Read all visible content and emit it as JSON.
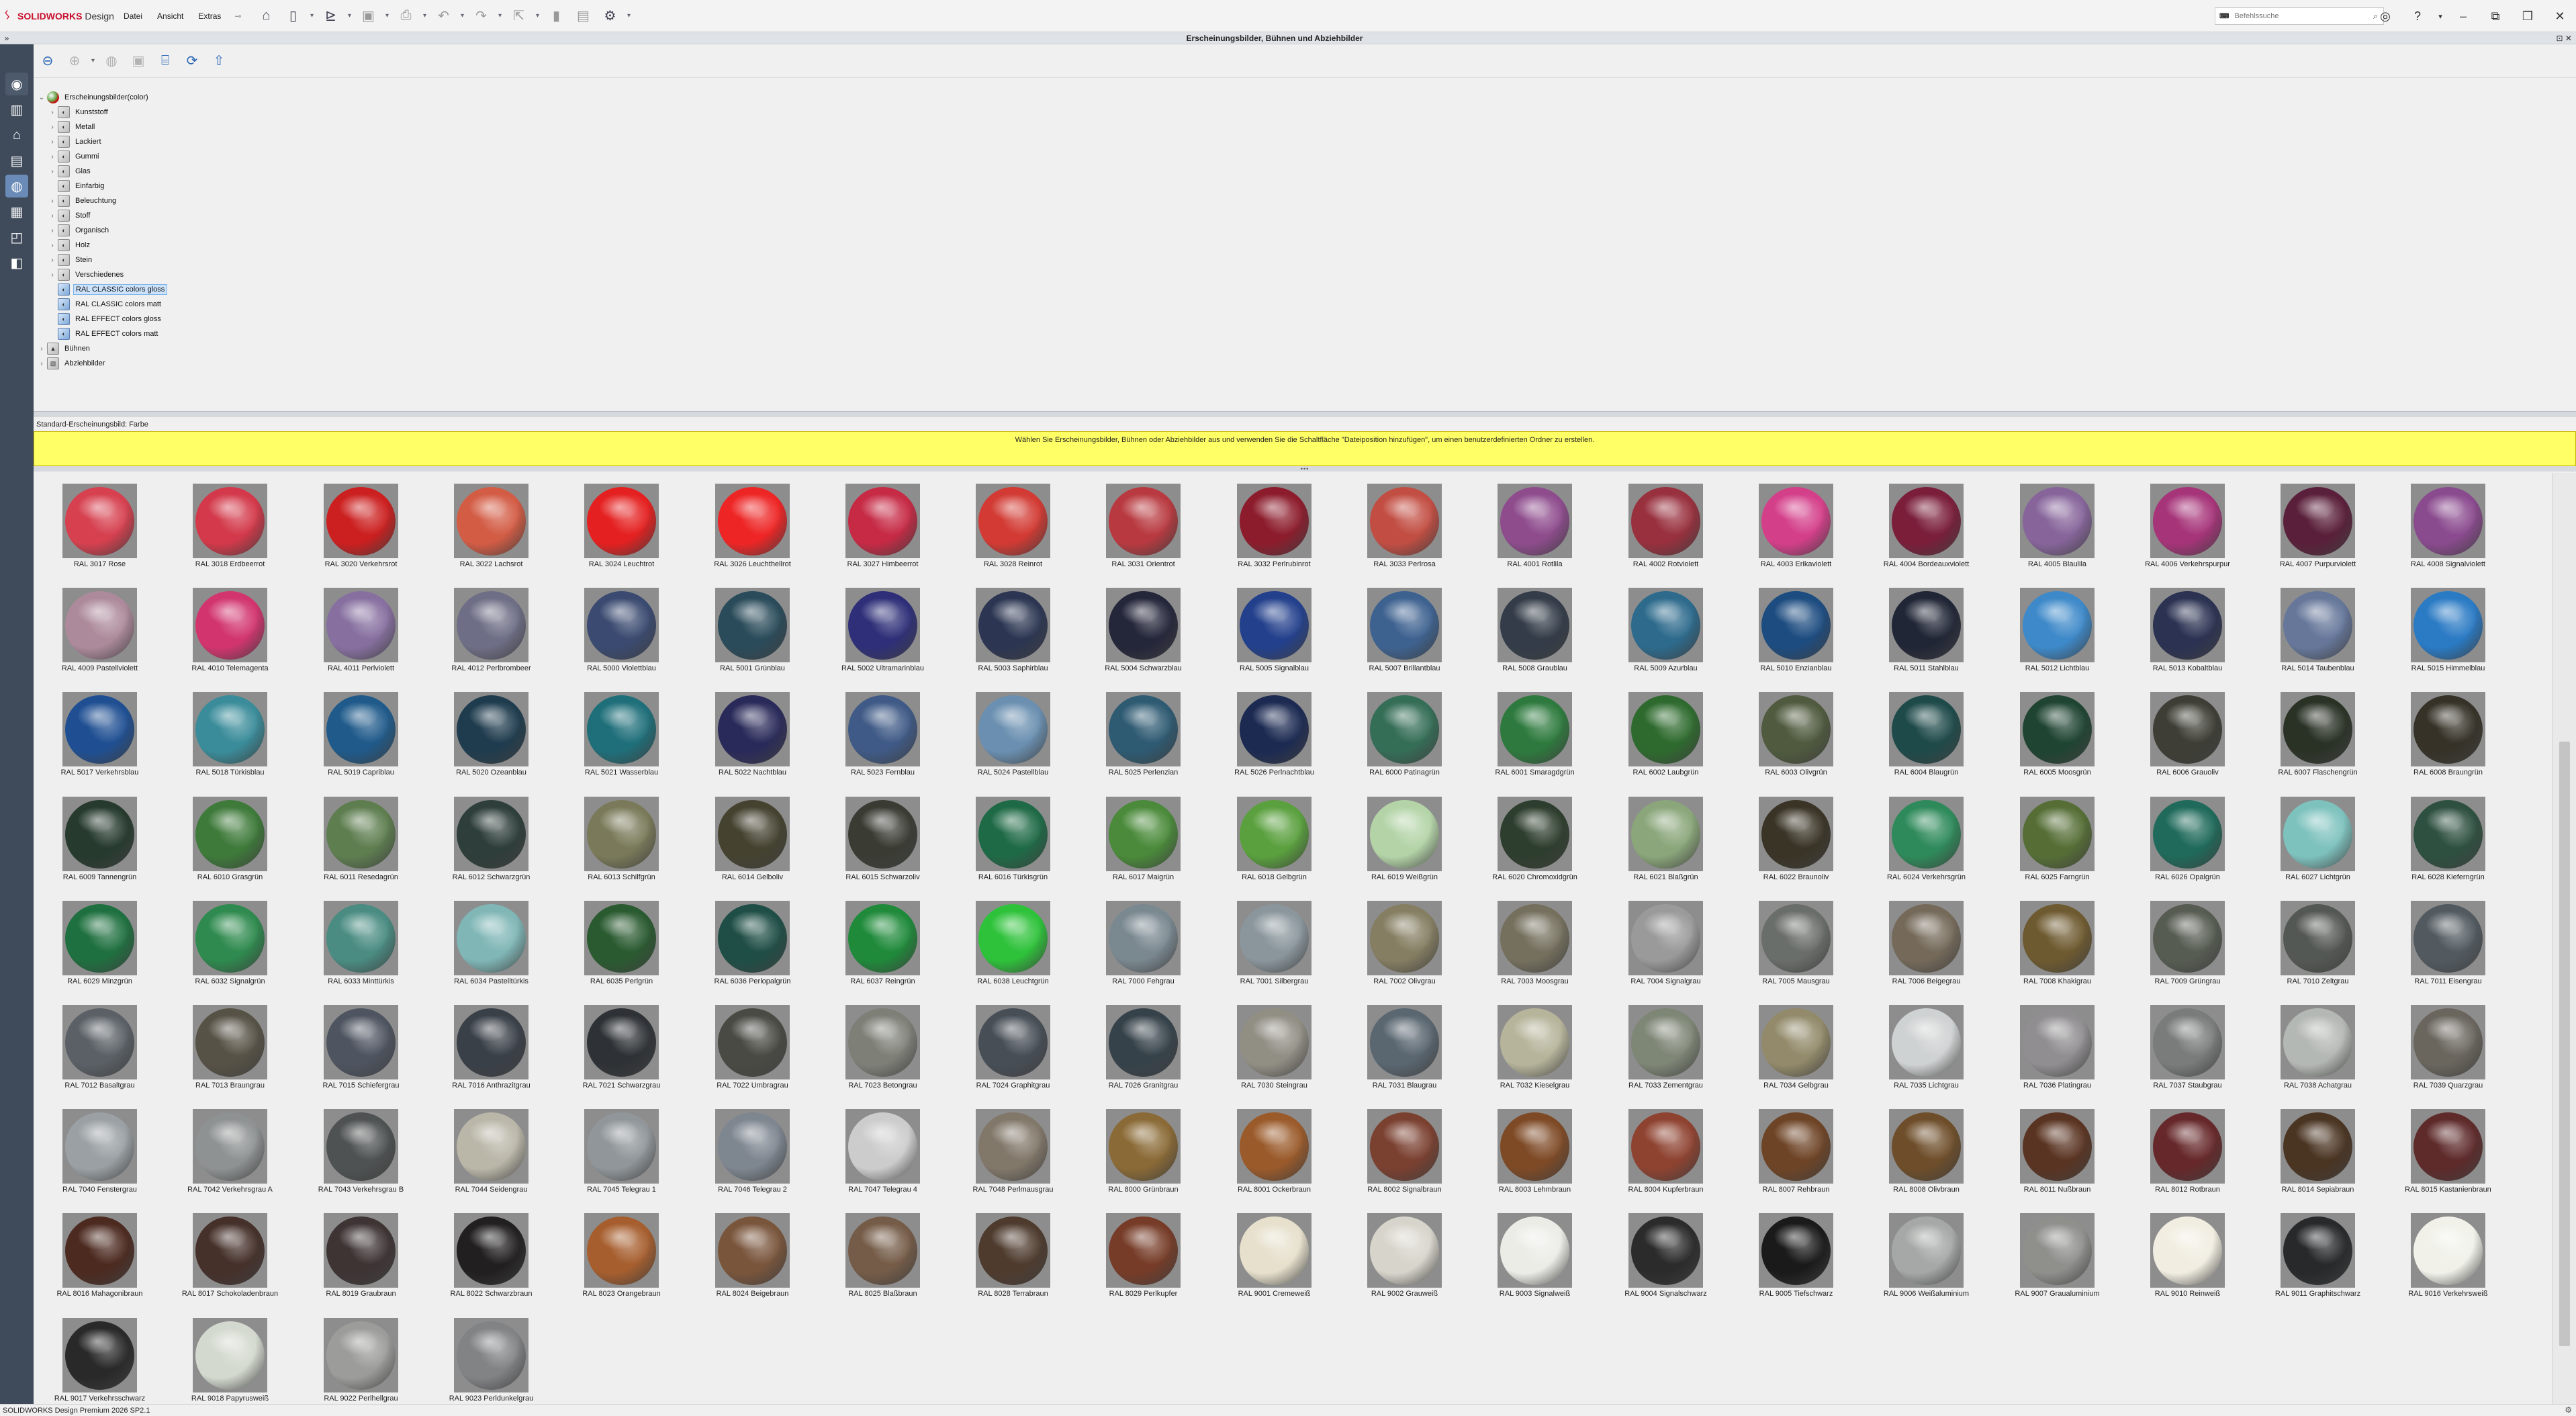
{
  "app": {
    "brand_solid": "SOLID",
    "brand_works": "WORKS",
    "brand_suffix": "Design",
    "brand_color": "#c8102e",
    "menu": [
      "Datei",
      "Ansicht",
      "Extras"
    ],
    "search_placeholder": "Befehlssuche",
    "status_text": "SOLIDWORKS Design Premium 2026 SP2.1"
  },
  "pane": {
    "title": "Erscheinungsbilder, Bühnen und Abziehbilder",
    "default_label": "Standard-Erscheinungsbild: Farbe",
    "info_message": "Wählen Sie Erscheinungsbilder, Bühnen oder Abziehbilder aus und verwenden Sie die Schaltfläche \"Dateiposition hinzufügen\", um einen benutzerdefinierten Ordner zu erstellen.",
    "info_color": "#ffff66"
  },
  "tree": {
    "root": "Erscheinungsbilder(color)",
    "children": [
      "Kunststoff",
      "Metall",
      "Lackiert",
      "Gummi",
      "Glas",
      "Einfarbig",
      "Beleuchtung",
      "Stoff",
      "Organisch",
      "Holz",
      "Stein",
      "Verschiedenes",
      "RAL CLASSIC colors gloss",
      "RAL CLASSIC colors matt",
      "RAL EFFECT colors gloss",
      "RAL EFFECT colors matt"
    ],
    "selected": "RAL CLASSIC colors gloss",
    "others": [
      "Bühnen",
      "Abziehbilder"
    ]
  },
  "swatches": [
    {
      "label": "RAL 3017 Rose",
      "color": "#d6404f"
    },
    {
      "label": "RAL 3018 Erdbeerrot",
      "color": "#d3394a"
    },
    {
      "label": "RAL 3020 Verkehrsrot",
      "color": "#cc1f1f"
    },
    {
      "label": "RAL 3022 Lachsrot",
      "color": "#d35c45"
    },
    {
      "label": "RAL 3024 Leuchtrot",
      "color": "#e52020"
    },
    {
      "label": "RAL 3026 Leuchthellrot",
      "color": "#ee2525"
    },
    {
      "label": "RAL 3027 Himbeerrot",
      "color": "#c62a45"
    },
    {
      "label": "RAL 3028 Reinrot",
      "color": "#d23a33"
    },
    {
      "label": "RAL 3031 Orientrot",
      "color": "#b83a40"
    },
    {
      "label": "RAL 3032 Perlrubinrot",
      "color": "#8c1c2c"
    },
    {
      "label": "RAL 3033 Perlrosa",
      "color": "#c24e43"
    },
    {
      "label": "RAL 4001 Rotlila",
      "color": "#8e4c8d"
    },
    {
      "label": "RAL 4002 Rotviolett",
      "color": "#98303e"
    },
    {
      "label": "RAL 4003 Erikaviolett",
      "color": "#d43f8a"
    },
    {
      "label": "RAL 4004 Bordeauxviolett",
      "color": "#7a1e3a"
    },
    {
      "label": "RAL 4005 Blaulila",
      "color": "#87659b"
    },
    {
      "label": "RAL 4006 Verkehrspurpur",
      "color": "#a63479"
    },
    {
      "label": "RAL 4007 Purpurviolett",
      "color": "#5a1f3a"
    },
    {
      "label": "RAL 4008 Signalviolett",
      "color": "#8a4a8e"
    },
    {
      "label": "RAL 4009 Pastellviolett",
      "color": "#ad8a9b"
    },
    {
      "label": "RAL 4010 Telemagenta",
      "color": "#d2356e"
    },
    {
      "label": "RAL 4011 Perlviolett",
      "color": "#8770a0"
    },
    {
      "label": "RAL 4012 Perlbrombeer",
      "color": "#6e6e86"
    },
    {
      "label": "RAL 5000 Violettblau",
      "color": "#3a4a70"
    },
    {
      "label": "RAL 5001 Grünblau",
      "color": "#2a4b5a"
    },
    {
      "label": "RAL 5002 Ultramarinblau",
      "color": "#2e2f78"
    },
    {
      "label": "RAL 5003 Saphirblau",
      "color": "#2c3652"
    },
    {
      "label": "RAL 5004 Schwarzblau",
      "color": "#24263a"
    },
    {
      "label": "RAL 5005 Signalblau",
      "color": "#23408c"
    },
    {
      "label": "RAL 5007 Brillantblau",
      "color": "#3e6290"
    },
    {
      "label": "RAL 5008 Graublau",
      "color": "#333c48"
    },
    {
      "label": "RAL 5009 Azurblau",
      "color": "#2d6a8c"
    },
    {
      "label": "RAL 5010 Enzianblau",
      "color": "#1d4c80"
    },
    {
      "label": "RAL 5011 Stahlblau",
      "color": "#212636"
    },
    {
      "label": "RAL 5012 Lichtblau",
      "color": "#3d89c9"
    },
    {
      "label": "RAL 5013 Kobaltblau",
      "color": "#2b3252"
    },
    {
      "label": "RAL 5014 Taubenblau",
      "color": "#66779a"
    },
    {
      "label": "RAL 5015 Himmelblau",
      "color": "#2a7ac4"
    },
    {
      "label": "RAL 5017 Verkehrsblau",
      "color": "#1f4f92"
    },
    {
      "label": "RAL 5018 Türkisblau",
      "color": "#3a8c9a"
    },
    {
      "label": "RAL 5019 Capriblau",
      "color": "#1f5a8a"
    },
    {
      "label": "RAL 5020 Ozeanblau",
      "color": "#1f3c4e"
    },
    {
      "label": "RAL 5021 Wasserblau",
      "color": "#1f6f7a"
    },
    {
      "label": "RAL 5022 Nachtblau",
      "color": "#2a2a5a"
    },
    {
      "label": "RAL 5023 Fernblau",
      "color": "#3f5a86"
    },
    {
      "label": "RAL 5024 Pastellblau",
      "color": "#6a8fb0"
    },
    {
      "label": "RAL 5025 Perlenzian",
      "color": "#2e5a72"
    },
    {
      "label": "RAL 5026 Perlnachtblau",
      "color": "#1c2a52"
    },
    {
      "label": "RAL 6000 Patinagrün",
      "color": "#356e57"
    },
    {
      "label": "RAL 6001 Smaragdgrün",
      "color": "#2e7a3e"
    },
    {
      "label": "RAL 6002 Laubgrün",
      "color": "#2e6a2e"
    },
    {
      "label": "RAL 6003 Olivgrün",
      "color": "#4f5a3e"
    },
    {
      "label": "RAL 6004 Blaugrün",
      "color": "#1f4a4a"
    },
    {
      "label": "RAL 6005 Moosgrün",
      "color": "#1f4432"
    },
    {
      "label": "RAL 6006 Grauoliv",
      "color": "#3e3e36"
    },
    {
      "label": "RAL 6007 Flaschengrün",
      "color": "#2a3226"
    },
    {
      "label": "RAL 6008 Braungrün",
      "color": "#363228"
    },
    {
      "label": "RAL 6009 Tannengrün",
      "color": "#263a2e"
    },
    {
      "label": "RAL 6010 Grasgrün",
      "color": "#3e7a3a"
    },
    {
      "label": "RAL 6011 Resedagrün",
      "color": "#5e7e50"
    },
    {
      "label": "RAL 6012 Schwarzgrün",
      "color": "#2e3e3a"
    },
    {
      "label": "RAL 6013 Schilfgrün",
      "color": "#7a7a5a"
    },
    {
      "label": "RAL 6014 Gelboliv",
      "color": "#454230"
    },
    {
      "label": "RAL 6015 Schwarzoliv",
      "color": "#3a3c34"
    },
    {
      "label": "RAL 6016 Türkisgrün",
      "color": "#1f6a46"
    },
    {
      "label": "RAL 6017 Maigrün",
      "color": "#4a8a3a"
    },
    {
      "label": "RAL 6018 Gelbgrün",
      "color": "#5aa03e"
    },
    {
      "label": "RAL 6019 Weißgrün",
      "color": "#b4d4a8"
    },
    {
      "label": "RAL 6020 Chromoxidgrün",
      "color": "#2e3e2e"
    },
    {
      "label": "RAL 6021 Blaßgrün",
      "color": "#8aa67a"
    },
    {
      "label": "RAL 6022 Braunoliv",
      "color": "#3a3426"
    },
    {
      "label": "RAL 6024 Verkehrsgrün",
      "color": "#2e8a5a"
    },
    {
      "label": "RAL 6025 Farngrün",
      "color": "#566e36"
    },
    {
      "label": "RAL 6026 Opalgrün",
      "color": "#1f6a5a"
    },
    {
      "label": "RAL 6027 Lichtgrün",
      "color": "#7ec2be"
    },
    {
      "label": "RAL 6028 Kieferngrün",
      "color": "#2e5040"
    },
    {
      "label": "RAL 6029 Minzgrün",
      "color": "#1f7040"
    },
    {
      "label": "RAL 6032 Signalgrün",
      "color": "#2e8a4e"
    },
    {
      "label": "RAL 6033 Minttürkis",
      "color": "#4a8c82"
    },
    {
      "label": "RAL 6034 Pastelltürkis",
      "color": "#80b6b6"
    },
    {
      "label": "RAL 6035 Perlgrün",
      "color": "#2a5a30"
    },
    {
      "label": "RAL 6036 Perlopalgrün",
      "color": "#1f4e46"
    },
    {
      "label": "RAL 6037 Reingrün",
      "color": "#1f8a3a"
    },
    {
      "label": "RAL 6038 Leuchtgrün",
      "color": "#2ec23a"
    },
    {
      "label": "RAL 7000 Fehgrau",
      "color": "#7a8890"
    },
    {
      "label": "RAL 7001 Silbergrau",
      "color": "#8a969c"
    },
    {
      "label": "RAL 7002 Olivgrau",
      "color": "#857e62"
    },
    {
      "label": "RAL 7003 Moosgrau",
      "color": "#75705e"
    },
    {
      "label": "RAL 7004 Signalgrau",
      "color": "#9a9a9a"
    },
    {
      "label": "RAL 7005 Mausgrau",
      "color": "#6a6e6a"
    },
    {
      "label": "RAL 7006 Beigegrau",
      "color": "#756a5a"
    },
    {
      "label": "RAL 7008 Khakigrau",
      "color": "#6e5a30"
    },
    {
      "label": "RAL 7009 Grüngrau",
      "color": "#565c52"
    },
    {
      "label": "RAL 7010 Zeltgrau",
      "color": "#545854"
    },
    {
      "label": "RAL 7011 Eisengrau",
      "color": "#525a60"
    },
    {
      "label": "RAL 7012 Basaltgrau",
      "color": "#5a6066"
    },
    {
      "label": "RAL 7013 Braungrau",
      "color": "#575246"
    },
    {
      "label": "RAL 7015 Schiefergrau",
      "color": "#4e5460"
    },
    {
      "label": "RAL 7016 Anthrazitgrau",
      "color": "#3a4048"
    },
    {
      "label": "RAL 7021 Schwarzgrau",
      "color": "#2e3236"
    },
    {
      "label": "RAL 7022 Umbragrau",
      "color": "#4a4a44"
    },
    {
      "label": "RAL 7023 Betongrau",
      "color": "#7e8078"
    },
    {
      "label": "RAL 7024 Graphitgrau",
      "color": "#474e56"
    },
    {
      "label": "RAL 7026 Granitgrau",
      "color": "#36424a"
    },
    {
      "label": "RAL 7030 Steingrau",
      "color": "#918e84"
    },
    {
      "label": "RAL 7031 Blaugrau",
      "color": "#5a6670"
    },
    {
      "label": "RAL 7032 Kieselgrau",
      "color": "#b6b49a"
    },
    {
      "label": "RAL 7033 Zementgrau",
      "color": "#7e8676"
    },
    {
      "label": "RAL 7034 Gelbgrau",
      "color": "#928a6a"
    },
    {
      "label": "RAL 7035 Lichtgrau",
      "color": "#cfd2d2"
    },
    {
      "label": "RAL 7036 Platingrau",
      "color": "#908e90"
    },
    {
      "label": "RAL 7037 Staubgrau",
      "color": "#7a7c7c"
    },
    {
      "label": "RAL 7038 Achatgrau",
      "color": "#b4b8b4"
    },
    {
      "label": "RAL 7039 Quarzgrau",
      "color": "#6a665e"
    },
    {
      "label": "RAL 7040 Fenstergrau",
      "color": "#9aa0a4"
    },
    {
      "label": "RAL 7042 Verkehrsgrau A",
      "color": "#8e9292"
    },
    {
      "label": "RAL 7043 Verkehrsgrau B",
      "color": "#4e5252"
    },
    {
      "label": "RAL 7044 Seidengrau",
      "color": "#bab6a8"
    },
    {
      "label": "RAL 7045 Telegrau 1",
      "color": "#90969a"
    },
    {
      "label": "RAL 7046 Telegrau 2",
      "color": "#7e8690"
    },
    {
      "label": "RAL 7047 Telegrau 4",
      "color": "#cccccc"
    },
    {
      "label": "RAL 7048 Perlmausgrau",
      "color": "#82786a"
    },
    {
      "label": "RAL 8000 Grünbraun",
      "color": "#8a6a36"
    },
    {
      "label": "RAL 8001 Ockerbraun",
      "color": "#9a5a2a"
    },
    {
      "label": "RAL 8002 Signalbraun",
      "color": "#7a4030"
    },
    {
      "label": "RAL 8003 Lehmbraun",
      "color": "#7e4a26"
    },
    {
      "label": "RAL 8004 Kupferbraun",
      "color": "#8e4230"
    },
    {
      "label": "RAL 8007 Rehbraun",
      "color": "#6e4426"
    },
    {
      "label": "RAL 8008 Olivbraun",
      "color": "#6e4e2a"
    },
    {
      "label": "RAL 8011 Nußbraun",
      "color": "#5a3422"
    },
    {
      "label": "RAL 8012 Rotbraun",
      "color": "#66282a"
    },
    {
      "label": "RAL 8014 Sepiabraun",
      "color": "#4a3422"
    },
    {
      "label": "RAL 8015 Kastanienbraun",
      "color": "#5e2a2a"
    },
    {
      "label": "RAL 8016 Mahagonibraun",
      "color": "#4c2a20"
    },
    {
      "label": "RAL 8017 Schokoladenbraun",
      "color": "#45302a"
    },
    {
      "label": "RAL 8019 Graubraun",
      "color": "#3e3434"
    },
    {
      "label": "RAL 8022 Schwarzbraun",
      "color": "#211f20"
    },
    {
      "label": "RAL 8023 Orangebraun",
      "color": "#a65e2e"
    },
    {
      "label": "RAL 8024 Beigebraun",
      "color": "#79553c"
    },
    {
      "label": "RAL 8025 Blaßbraun",
      "color": "#755c48"
    },
    {
      "label": "RAL 8028 Terrabraun",
      "color": "#4e3b2e"
    },
    {
      "label": "RAL 8029 Perlkupfer",
      "color": "#763c28"
    },
    {
      "label": "RAL 9001 Cremeweiß",
      "color": "#e6e0cc"
    },
    {
      "label": "RAL 9002 Grauweiß",
      "color": "#d7d5cb"
    },
    {
      "label": "RAL 9003 Signalweiß",
      "color": "#ecece7"
    },
    {
      "label": "RAL 9004 Signalschwarz",
      "color": "#2b2b2c"
    },
    {
      "label": "RAL 9005 Tiefschwarz",
      "color": "#1a1a1a"
    },
    {
      "label": "RAL 9006 Weißaluminium",
      "color": "#a5a8a6"
    },
    {
      "label": "RAL 9007 Graualuminium",
      "color": "#8f8f8c"
    },
    {
      "label": "RAL 9010 Reinweiß",
      "color": "#f1ede1"
    },
    {
      "label": "RAL 9011 Graphitschwarz",
      "color": "#27292b"
    },
    {
      "label": "RAL 9016 Verkehrsweiß",
      "color": "#f1f1ea"
    },
    {
      "label": "RAL 9017 Verkehrsschwarz",
      "color": "#2a292a"
    },
    {
      "label": "RAL 9018 Papyrusweiß",
      "color": "#d3d9cf"
    },
    {
      "label": "RAL 9022 Perlhellgrau",
      "color": "#9c9c9a"
    },
    {
      "label": "RAL 9023 Perldunkelgrau",
      "color": "#828385"
    }
  ]
}
